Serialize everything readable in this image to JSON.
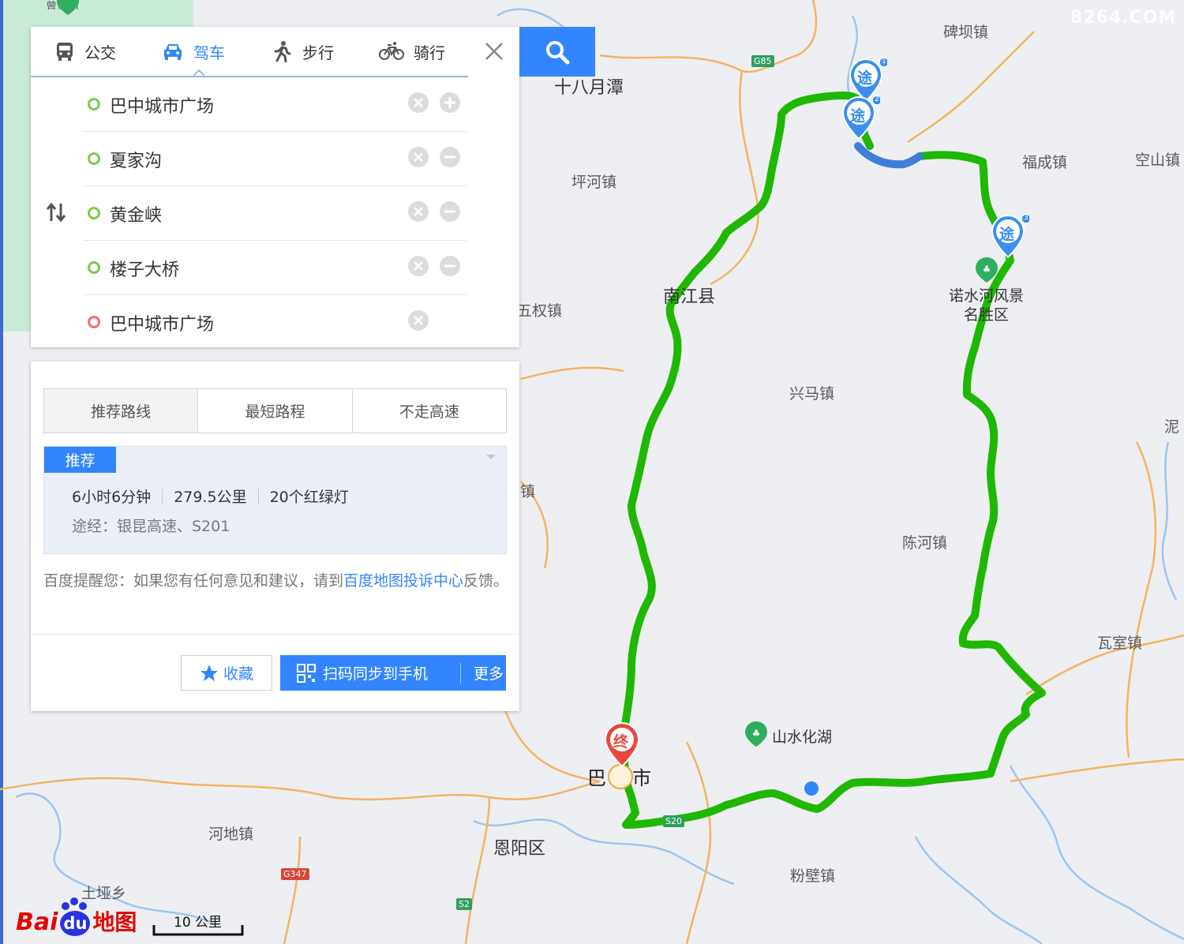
{
  "tabs": {
    "bus": "公交",
    "drive": "驾车",
    "walk": "步行",
    "ride": "骑行"
  },
  "stops": [
    {
      "name": "巴中城市广场",
      "type": "start"
    },
    {
      "name": "夏家沟",
      "type": "via"
    },
    {
      "name": "黄金峡",
      "type": "via"
    },
    {
      "name": "楼子大桥",
      "type": "via"
    },
    {
      "name": "巴中城市广场",
      "type": "end"
    }
  ],
  "route_options": {
    "recommended": "推荐路线",
    "shortest": "最短路程",
    "no_highway": "不走高速"
  },
  "plan": {
    "tag": "推荐",
    "duration": "6小时6分钟",
    "distance": "279.5公里",
    "lights": "20个红绿灯",
    "via": "途经：银昆高速、S201"
  },
  "notice": {
    "prefix": "百度提醒您：如果您有任何意见和建议，请到",
    "link": "百度地图投诉中心",
    "suffix": "反馈。"
  },
  "actions": {
    "favorite": "收藏",
    "sync": "扫码同步到手机",
    "more": "更多"
  },
  "map": {
    "places": {
      "beibazhen": "碑坝镇",
      "shibayuetan": "十八月潭",
      "pinghezhen": "坪河镇",
      "fuchengzhen": "福成镇",
      "kongshanzhen": "空山镇",
      "nanjiangxian": "南江县",
      "nuoshuihe_1": "诺水河风景",
      "nuoshuihe_2": "名胜区",
      "wuquanzhen": "五权镇",
      "xingmazhen": "兴马镇",
      "chenhezhen": "陈河镇",
      "ni": "泥",
      "washizhen": "瓦室镇",
      "shanshuihuahu": "山水化湖",
      "bazhongshi_1": "巴",
      "bazhongshi_2": "市",
      "hedizhen": "河地镇",
      "enyangqu": "恩阳区",
      "fenbizhen": "粉壁镇",
      "tuyaxiang": "土垭乡",
      "zhen_partial": "镇",
      "topleft_partial": "曾家山"
    },
    "shields": {
      "g85": "G85",
      "s20": "S20",
      "g347": "G347",
      "s2": "S2"
    },
    "markers": {
      "via": "途",
      "end": "终",
      "via1": "1",
      "via2": "2",
      "via3": "3"
    },
    "scale": "10 公里",
    "logo_bai": "Bai",
    "logo_du": "du",
    "logo_ditu": "地图",
    "watermark": "8264.COM",
    "colors": {
      "route": "#1fb800",
      "route_segment": "#3f7fd9",
      "water": "#9dc5f2",
      "road": "#f5b45f",
      "primary": "#3385ff"
    }
  }
}
